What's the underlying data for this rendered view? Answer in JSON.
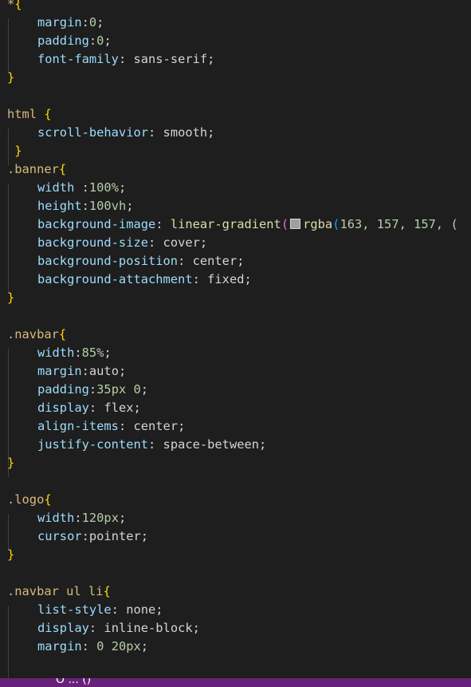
{
  "editor": {
    "lines": [
      {
        "sel": "*",
        "open": "{"
      },
      {
        "prop": "margin",
        "sep": ":",
        "val": "0",
        "end": ";"
      },
      {
        "prop": "padding",
        "sep": ":",
        "val": "0",
        "end": ";"
      },
      {
        "prop": "font-family",
        "sep": ": ",
        "val": "sans-serif",
        "end": ";"
      },
      {
        "close": "}"
      },
      {},
      {
        "sel": "html ",
        "open": "{"
      },
      {
        "prop": "scroll-behavior",
        "sep": ": ",
        "val": "smooth",
        "end": ";"
      },
      {
        "close": " }"
      },
      {
        "sel": ".banner",
        "open": "{"
      },
      {
        "prop": "width ",
        "sep": ":",
        "val": "100%",
        "end": ";"
      },
      {
        "prop": "height",
        "sep": ":",
        "val": "100vh",
        "end": ";"
      },
      {
        "prop": "background-image",
        "sep": ": ",
        "fn": "linear-gradient",
        "paren": "(",
        "swatch": true,
        "fn2": "rgba",
        "paren2": "(",
        "nums": "163, 157, 157, (",
        "swatch_color": "#a39d9d"
      },
      {
        "prop": "background-size",
        "sep": ": ",
        "val": "cover",
        "end": ";"
      },
      {
        "prop": "background-position",
        "sep": ": ",
        "val": "center",
        "end": ";"
      },
      {
        "prop": "background-attachment",
        "sep": ": ",
        "val": "fixed",
        "end": ";"
      },
      {
        "close": "}"
      },
      {},
      {
        "sel": ".navbar",
        "open": "{"
      },
      {
        "prop": "width",
        "sep": ":",
        "val": "85%",
        "end": ";"
      },
      {
        "prop": "margin",
        "sep": ":",
        "val": "auto",
        "end": ";"
      },
      {
        "prop": "padding",
        "sep": ":",
        "val": "35px 0",
        "end": ";"
      },
      {
        "prop": "display",
        "sep": ": ",
        "val": "flex",
        "end": ";"
      },
      {
        "prop": "align-items",
        "sep": ": ",
        "val": "center",
        "end": ";"
      },
      {
        "prop": "justify-content",
        "sep": ": ",
        "val": "space-between",
        "end": ";"
      },
      {
        "close": "}"
      },
      {},
      {
        "sel": ".logo",
        "open": "{"
      },
      {
        "prop": "width",
        "sep": ":",
        "val": "120px",
        "end": ";"
      },
      {
        "prop": "cursor",
        "sep": ":",
        "val": "pointer",
        "end": ";"
      },
      {
        "close": "}"
      },
      {},
      {
        "sel": ".navbar ul li",
        "open": "{"
      },
      {
        "prop": "list-style",
        "sep": ": ",
        "val": "none",
        "end": ";"
      },
      {
        "prop": "display",
        "sep": ": ",
        "val": "inline-block",
        "end": ";"
      },
      {
        "prop": "margin",
        "sep": ": ",
        "val": "0 20px",
        "end": ";"
      }
    ]
  },
  "status_bar": {
    "partial_text": "O  ...  ()",
    "color": "#68217a"
  },
  "colors": {
    "background": "#1e1e1e",
    "selector": "#d7ba7d",
    "property": "#9cdcfe",
    "number": "#b5cea8",
    "brace": "#ffd700",
    "function": "#dcdcaa"
  }
}
